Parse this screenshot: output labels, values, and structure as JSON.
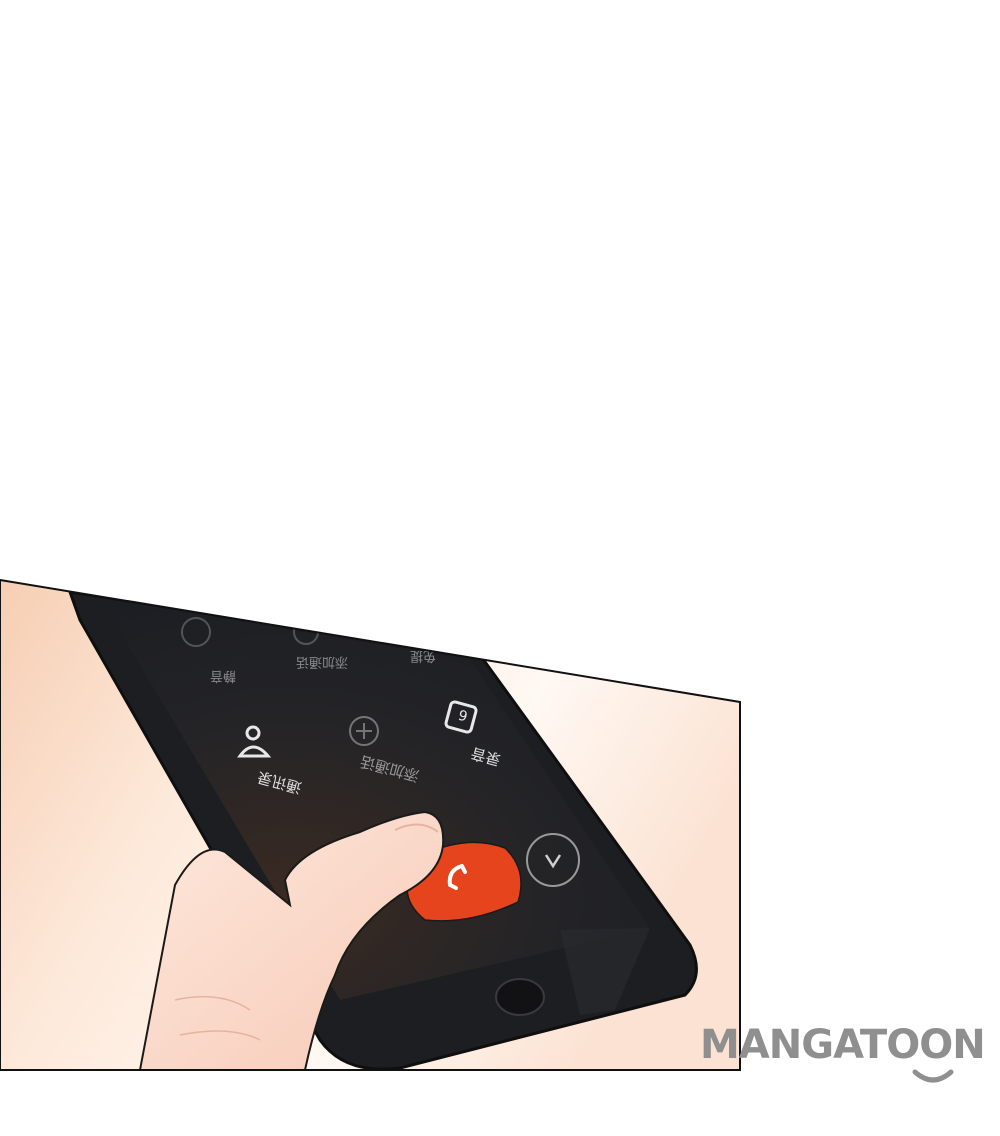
{
  "panel": {
    "description_colors": {
      "skin_light": "#fbe6d6",
      "skin_mid": "#f6cfb6",
      "phone_body": "#1d1e22",
      "screen_dark": "#232326",
      "end_call": "#e5441c",
      "outline": "#1a1a1a"
    }
  },
  "phone_screen": {
    "row1": [
      {
        "icon": "power-icon",
        "label": "静音"
      },
      {
        "icon": "add-call-icon",
        "label": "添加通话"
      },
      {
        "icon": "speaker-icon",
        "label": "免提"
      }
    ],
    "row2": [
      {
        "icon": "contacts-icon",
        "label": "通讯录"
      },
      {
        "icon": "add-icon",
        "label": "添加通话"
      },
      {
        "icon": "record-icon",
        "label": "录音"
      }
    ],
    "end_call_icon": "phone-hangup-icon",
    "collapse_icon": "chevron-down-icon"
  },
  "watermark": {
    "text": "MANGATOON",
    "color": "#8f8f8f"
  }
}
